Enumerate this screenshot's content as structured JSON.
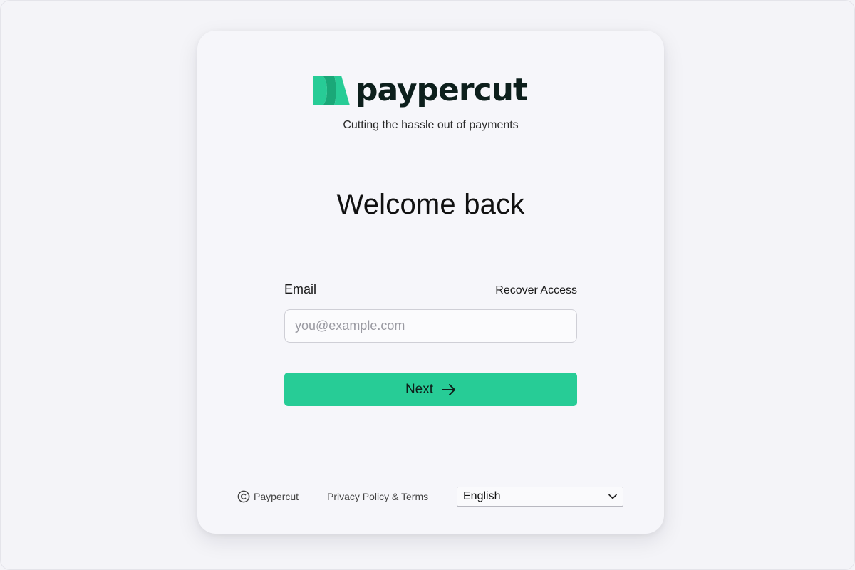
{
  "brand": {
    "name": "paypercut",
    "tagline": "Cutting the hassle out of payments",
    "color": "#27cc96"
  },
  "login": {
    "heading": "Welcome back",
    "email_label": "Email",
    "recover_link": "Recover Access",
    "email_placeholder": "you@example.com",
    "email_value": "",
    "next_label": "Next",
    "next_icon": "arrow-right-icon"
  },
  "footer": {
    "copyright_icon": "copyright-icon",
    "copyright_text": "Paypercut",
    "privacy_link": "Privacy Policy & Terms",
    "language": {
      "selected": "English",
      "icon": "chevron-down-icon"
    }
  }
}
